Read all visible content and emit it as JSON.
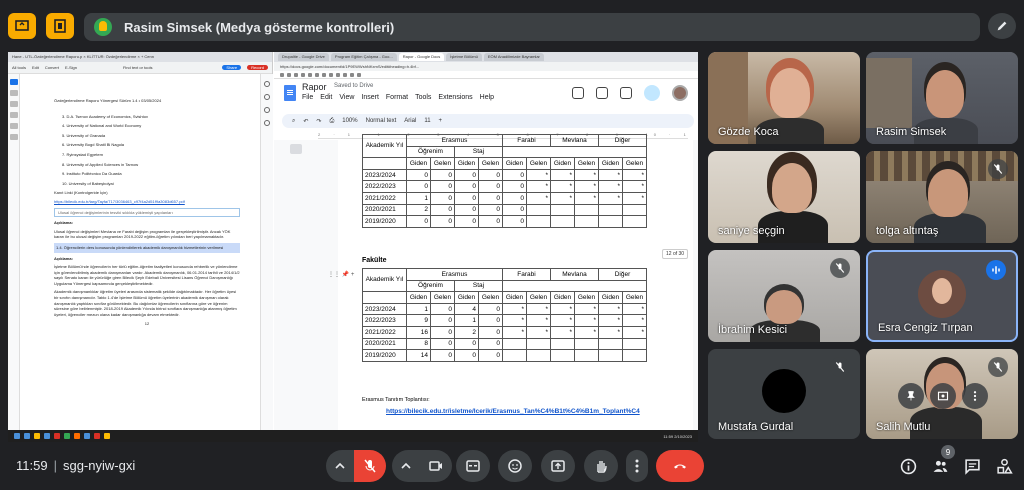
{
  "topbar": {
    "presenter_label": "Rasim Simsek (Medya gösterme kontrolleri)"
  },
  "screen": {
    "left_window": {
      "tabs": "Hane  -  UTL-Özdeğerlendirme Raporu.p  ×  KLİTTUR: Özdeğerlendirme  ×  + Cenn",
      "toolbar": [
        "All tools",
        "Edit",
        "Convert",
        "E-Sign"
      ],
      "find_text": "Find text or tools",
      "share_label": "Share",
      "rec_label": "Record",
      "doc_heading": "Özdeğerlendirme Raporu Yönergesi    Sürüm 1.4 • 03/05/2024",
      "list": [
        "3.   D.A. Tsenov Academy of Economics, Svishtov",
        "4.   University of National and World Economy",
        "5.   University of Granada",
        "6.   University Bogd Shatil Bi Nagola",
        "7.   Ryinsystad Egyetem",
        "8.   University of Applied Sciences in Tarnow",
        "9.   Instituto Politécnico Da Guarda",
        "10.  University of Babeşbolyai"
      ],
      "kanit_label": "Kanıt Linki  (Kontrolgeride  İçin)",
      "kanit_link": "https://bilecik.edu.tr/targ/Tayfa/717/3036463_c97f4a2d51f9a3083d657.pdf",
      "box_text": "Ulusal öğrenci değişimlerinin tesviki sıklıkla yüklemişti yapılanları",
      "aciklama1_label": "Açıklama:",
      "aciklama1_text": "Ulusal öğrenci değişimleri Mevlana ve Farabi değişim programları ile gerçekleştirilmiştir. Ancak YÖK kararı ile bu ulusal değişim programları 2019-2022 eğitim-öğretim yılından beri yapılmamaktadır.",
      "item_14_no": "1.4.",
      "item_14_text": "Öğrencilerin ders konusunda yönlendirilerek akademik danışmanlık hizmetlerinin verilmesi",
      "aciklama2_label": "Açıklama:",
      "aciklama2_text": "İşletme Bölümü'nde öğrencilerin her türlü eğitim-öğretim faaliyetleri konusunda rehberlik ve yönlendirme için görevlendirilmiş akademik danışmanları vardır. Akademik danışmanlık, 06.01.2014 tarihli ve 2014/1/2 sayılı Senato kararı ile yürürlüğe giren Bilecik Şeyh Edebali Üniversitesi Lisans Öğrenci Danışmanlığı Uygulama Yönergesi kapsamında gerçekleştirilmektedir.",
      "aciklama3_text": "Akademik danışmanlıklar öğretim üyeleri arasında sistematik şekilde dağıtılmaktadır. Her öğretim üyesi bir sınıfın danışmanıdır. Tablo 1.4'de İşletme Bölümü öğretim üyelerinin akademik danışman olarak danışmanlık yaptıkları sınıflar görülmektedir. Bu dağılımlar öğrencilerin sınıflarına göre ve öğrenim süresine göre belirlenmiştir. 2018-2019 Akademik Yılında birinci sınıflara danışmanlığa atanmış öğretim üyeleri, öğrenciler mezun olana kadar danışmanlığa devam etmektedir.",
      "page_number": "12"
    },
    "right_window": {
      "tabs": [
        "Drupalite - Google Drive",
        "Program Eğitim Çalışma - Goo...",
        "Rapor - Google Docs",
        "İşletme Bölümü",
        "EÖM Anadilimizde Bayramlar"
      ],
      "url": "https://docs.google.com/document/d/1P9EWWshNKxmS/edit#heading=h.4bf...",
      "doc_title": "Rapor",
      "saved": "Saved to Drive",
      "menu": [
        "File",
        "Edit",
        "View",
        "Insert",
        "Format",
        "Tools",
        "Extensions",
        "Help"
      ],
      "toolbar": {
        "zoom": "100%",
        "style": "Normal text",
        "font": "Arial",
        "size": "11"
      },
      "ruler": "2 · 1 · 1 · 2 · 3 · 4 · 5 · 6 · 7 · 8 · 9 · 10 · 11 · 12 · 13 · 14 · 15 · 16 · 17 · 18",
      "page_badge": "12 of 30",
      "table1": {
        "group_header": [
          "Akademik Yıl",
          "Erasmus",
          "Farabi",
          "Mevlana",
          "Diğer"
        ],
        "sub_header": [
          "Öğrenim",
          "Staj"
        ],
        "cols": [
          "Giden",
          "Gelen",
          "Giden",
          "Gelen",
          "Giden",
          "Gelen",
          "Giden",
          "Gelen",
          "Giden",
          "Gelen"
        ],
        "rows": [
          [
            "2023/2024",
            "0",
            "0",
            "0",
            "0",
            "0",
            "*",
            "*",
            "*",
            "*",
            "*"
          ],
          [
            "2022/2023",
            "0",
            "0",
            "0",
            "0",
            "0",
            "*",
            "*",
            "*",
            "*",
            "*"
          ],
          [
            "2021/2022",
            "1",
            "0",
            "0",
            "0",
            "0",
            "*",
            "*",
            "*",
            "*",
            "*"
          ],
          [
            "2020/2021",
            "2",
            "0",
            "0",
            "0",
            "0",
            "",
            "",
            "",
            "",
            ""
          ],
          [
            "2019/2020",
            "0",
            "0",
            "0",
            "0",
            "0",
            "",
            "",
            "",
            "",
            ""
          ]
        ]
      },
      "fakulte_label": "Fakülte",
      "table2": {
        "group_header": [
          "Akademik Yıl",
          "Erasmus",
          "Farabi",
          "Mevlana",
          "Diğer"
        ],
        "sub_header": [
          "Öğrenim",
          "Staj"
        ],
        "cols": [
          "Giden",
          "Gelen",
          "Giden",
          "Gelen",
          "Giden",
          "Gelen",
          "Giden",
          "Gelen",
          "Giden",
          "Gelen"
        ],
        "rows": [
          [
            "2023/2024",
            "1",
            "0",
            "4",
            "0",
            "*",
            "*",
            "*",
            "*",
            "*",
            "*"
          ],
          [
            "2022/2023",
            "9",
            "0",
            "1",
            "0",
            "*",
            "*",
            "*",
            "*",
            "*",
            "*"
          ],
          [
            "2021/2022",
            "16",
            "0",
            "2",
            "0",
            "*",
            "*",
            "*",
            "*",
            "*",
            "*"
          ],
          [
            "2020/2021",
            "8",
            "0",
            "0",
            "0",
            "",
            "",
            "",
            "",
            "",
            ""
          ],
          [
            "2019/2020",
            "14",
            "0",
            "0",
            "0",
            "",
            "",
            "",
            "",
            "",
            ""
          ]
        ]
      },
      "erasmus_note": "Erasmus Tanıtım Toplantısı:",
      "erasmus_link": "https://bilecik.edu.tr/isletme/Icerik/Erasmus_Tan%C4%B1t%C4%B1m_Toplant%C4"
    },
    "taskbar_clock": "11:59  2/10/2023"
  },
  "participants": [
    {
      "name": "Gözde Koca",
      "muted": false
    },
    {
      "name": "Rasim Simsek",
      "muted": false
    },
    {
      "name": "saniye seçgin",
      "muted": false
    },
    {
      "name": "tolga altıntaş",
      "muted": true
    },
    {
      "name": "İbrahim Kesici",
      "muted": true
    },
    {
      "name": "Esra Cengiz Tırpan",
      "muted": false,
      "speaking": true
    },
    {
      "name": "Mustafa Gurdal",
      "muted": true
    },
    {
      "name": "Salih Mutlu",
      "muted": true
    }
  ],
  "bottombar": {
    "time": "11:59",
    "separator": "|",
    "meeting_code": "sgg-nyiw-gxi",
    "people_count": "9"
  },
  "colors": {
    "background": "#202124",
    "panel": "#3c4043",
    "accent_yellow": "#f9ab00",
    "hangup_red": "#ea4335",
    "active_blue": "#8ab4f8"
  },
  "icons": [
    "present-icon",
    "layout-icon",
    "edit-icon",
    "mic-off-icon",
    "camera-icon",
    "captions-icon",
    "emoji-icon",
    "present-screen-icon",
    "hand-icon",
    "more-icon",
    "hangup-icon",
    "info-icon",
    "people-icon",
    "chat-icon",
    "activities-icon",
    "pin-icon",
    "frame-icon"
  ]
}
